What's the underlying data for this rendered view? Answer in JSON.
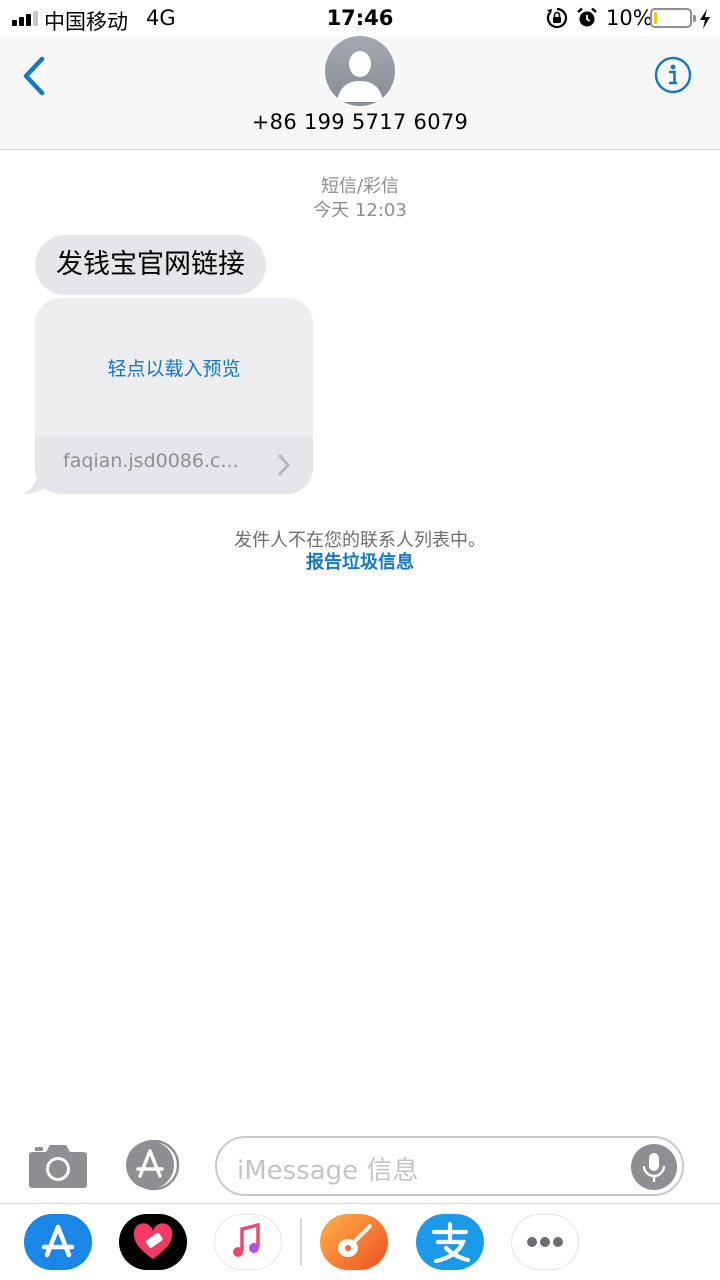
{
  "status_bar": {
    "carrier": "中国移动",
    "network": "4G",
    "time": "17:46",
    "battery_percent": "10%",
    "battery_level": 0.1
  },
  "header": {
    "contact_number": "+86 199 5717 6079"
  },
  "conversation": {
    "message_type": "短信/彩信",
    "timestamp": "今天 12:03",
    "message_text": "发钱宝官网链接",
    "link_preview": {
      "load_text": "轻点以载入预览",
      "url": "faqian.jsd0086.c..."
    },
    "sender_notice": "发件人不在您的联系人列表中。",
    "report_link": "报告垃圾信息"
  },
  "composer": {
    "placeholder": "iMessage 信息"
  },
  "app_drawer": {
    "apps": [
      "app-store",
      "digital-touch",
      "music",
      "garageband",
      "alipay",
      "more"
    ]
  },
  "colors": {
    "accent": "#1378c9",
    "bubble": "#e5e5ea",
    "meta_text": "#8e8e93"
  }
}
